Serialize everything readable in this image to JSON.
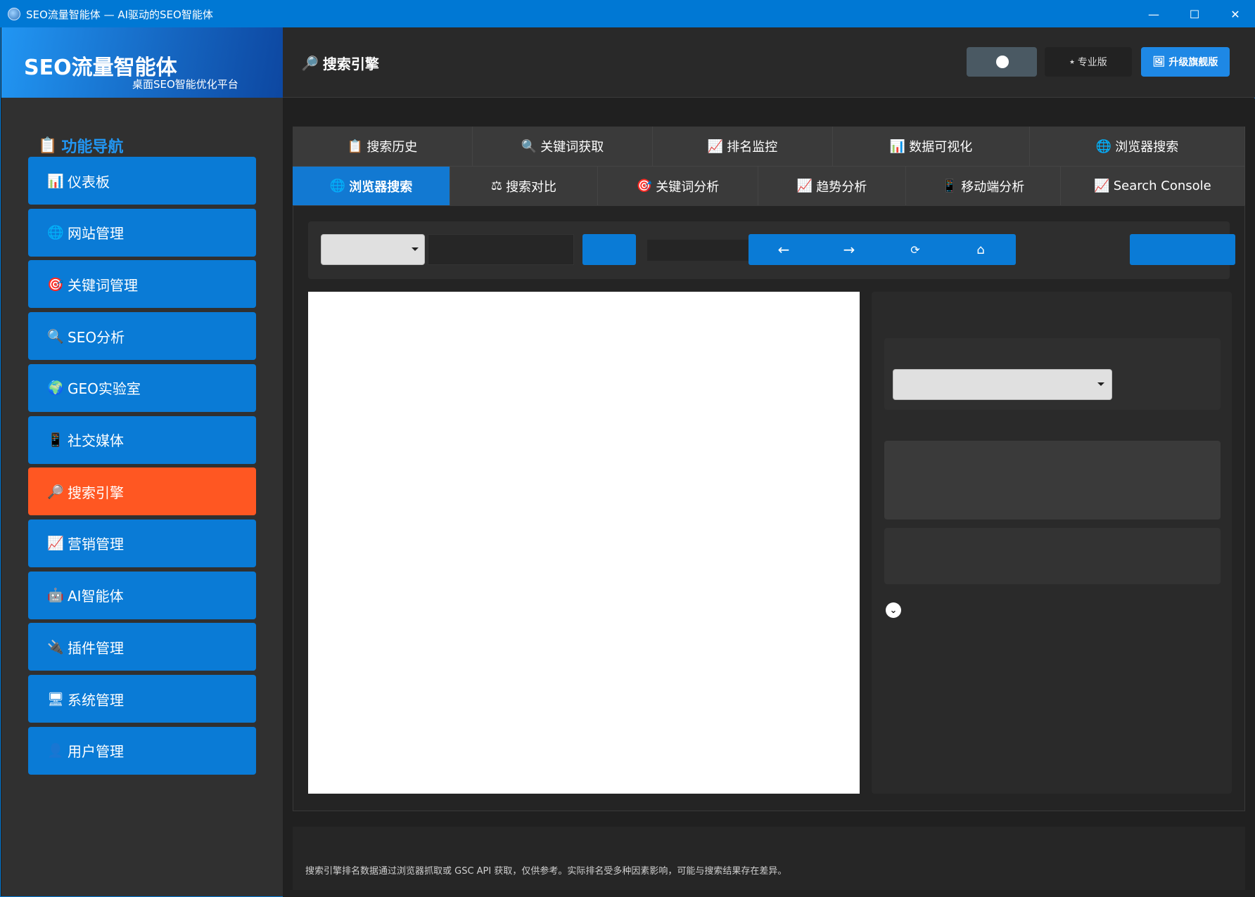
{
  "window": {
    "title": "SEO流量智能体 — AI驱动的SEO智能体",
    "controls": {
      "minimize": "—",
      "maximize": "☐",
      "close": "✕"
    }
  },
  "brand": {
    "title": "SEO流量智能体",
    "subtitle": "桌面SEO智能优化平台"
  },
  "sidebar": {
    "nav_title": "功能导航",
    "nav_icon": "📋",
    "items": [
      {
        "label": "仪表板",
        "icon": "📊",
        "icon_name": "chart-icon"
      },
      {
        "label": "网站管理",
        "icon": "🌐",
        "icon_name": "globe-icon"
      },
      {
        "label": "关键词管理",
        "icon": "🎯",
        "icon_name": "target-icon"
      },
      {
        "label": "SEO分析",
        "icon": "🔍",
        "icon_name": "magnifier-icon"
      },
      {
        "label": "GEO实验室",
        "icon": "🌍",
        "icon_name": "earth-icon"
      },
      {
        "label": "社交媒体",
        "icon": "📱",
        "icon_name": "phone-icon"
      },
      {
        "label": "搜索引擎",
        "icon": "🔎",
        "icon_name": "search-icon"
      },
      {
        "label": "营销管理",
        "icon": "📈",
        "icon_name": "trend-icon"
      },
      {
        "label": "AI智能体",
        "icon": "🤖",
        "icon_name": "robot-icon"
      },
      {
        "label": "插件管理",
        "icon": "🔌",
        "icon_name": "plugin-icon"
      },
      {
        "label": "系统管理",
        "icon": "🖥",
        "icon_name": "monitor-icon"
      },
      {
        "label": "用户管理",
        "icon": "👤",
        "icon_name": "user-icon"
      }
    ],
    "active_index": 6
  },
  "header": {
    "page_title": "搜索引擎",
    "page_icon": "🔎",
    "badge": "专业版",
    "badge_icon": "⭑",
    "upgrade": "升级旗舰版",
    "upgrade_icon": "🖼"
  },
  "tabs_row1": [
    {
      "label": "搜索历史",
      "icon": "📋"
    },
    {
      "label": "关键词获取",
      "icon": "🔍"
    },
    {
      "label": "排名监控",
      "icon": "📈"
    },
    {
      "label": "数据可视化",
      "icon": "📊"
    },
    {
      "label": "浏览器搜索",
      "icon": "🌐"
    }
  ],
  "tabs_row2": [
    {
      "label": "浏览器搜索",
      "icon": "🌐"
    },
    {
      "label": "搜索对比",
      "icon": "⚖"
    },
    {
      "label": "关键词分析",
      "icon": "🎯"
    },
    {
      "label": "趋势分析",
      "icon": "📈"
    },
    {
      "label": "移动端分析",
      "icon": "📱"
    },
    {
      "label": "Search Console",
      "icon": "📈"
    }
  ],
  "toolbar": {
    "back": "←",
    "forward": "→",
    "refresh": "⟳",
    "home": "⌂"
  },
  "footer": {
    "note": "搜索引擎排名数据通过浏览器抓取或 GSC API 获取，仅供参考。实际排名受多种因素影响，可能与搜索结果存在差异。"
  },
  "right_panel": {
    "expand_icon": "⌄"
  }
}
